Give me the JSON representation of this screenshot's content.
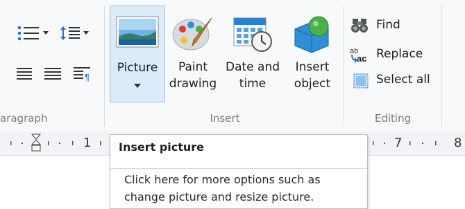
{
  "groups": {
    "paragraph": {
      "label": "aragraph"
    },
    "insert": {
      "label": "Insert",
      "picture": {
        "line1": "Picture",
        "dropdown_icon": "triangle-down"
      },
      "paint": {
        "line1": "Paint",
        "line2": "drawing"
      },
      "datetime": {
        "line1": "Date and",
        "line2": "time"
      },
      "object": {
        "line1": "Insert",
        "line2": "object"
      }
    },
    "editing": {
      "label": "Editing",
      "find": "Find",
      "replace": "Replace",
      "select_all": "Select all"
    }
  },
  "ruler": {
    "left_label": "1",
    "right_label_1": "7",
    "right_label_2": "8"
  },
  "tooltip": {
    "title": "Insert picture",
    "line1": "Click here for more options such as",
    "line2": "change picture and resize picture."
  },
  "colors": {
    "ribbon_bg": "#f8f9fb",
    "selected_bg": "#dcebf9",
    "selected_border": "#9ec2e6"
  }
}
